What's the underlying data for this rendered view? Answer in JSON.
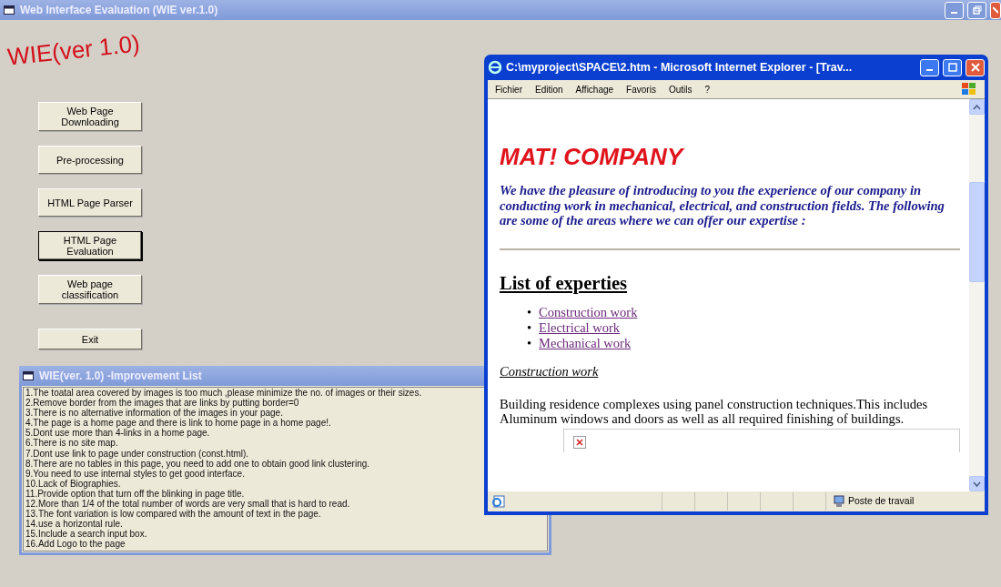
{
  "window": {
    "title": "Web Interface Evaluation (WIE ver.1.0)"
  },
  "logo": "WIE(ver 1.0)",
  "buttons": [
    {
      "label": "Web Page Downloading",
      "focused": false
    },
    {
      "label": "Pre-processing",
      "focused": false
    },
    {
      "label": "HTML Page Parser",
      "focused": false
    },
    {
      "label": "HTML Page Evaluation",
      "focused": true
    },
    {
      "label": "Web page classification",
      "focused": false
    },
    {
      "label": "Exit",
      "focused": false
    }
  ],
  "improvement_window": {
    "title": "WIE(ver. 1.0) -Improvement List",
    "items": [
      "1.The toatal area covered by images is too much ,please minimize the no. of images or their sizes.",
      "2.Remove border from the images that are links by putting border=0",
      "3.There is no alternative information of the images in your page.",
      "4.The page is a home page and there is link to home page in a home page!.",
      "5.Dont use more than 4-links in a home page.",
      "6.There is no site map.",
      "7.Dont use link to  page under construction (const.html).",
      "8.There are no tables in this page, you need to add one to obtain good link clustering.",
      "9.You need to use internal styles to get good interface.",
      "10.Lack of Biographies.",
      "11.Provide option that turn off the blinking in page title.",
      "12.More than 1/4 of the total number of words are very small that is hard to read.",
      "13.The font variation is low compared with the amount of text in the page.",
      "14.use a horizontal rule.",
      "15.Include a search input box.",
      "16.Add Logo to the page"
    ]
  },
  "browser": {
    "title": "C:\\myproject\\SPACE\\2.htm - Microsoft Internet Explorer - [Trav...",
    "menu": [
      "Fichier",
      "Edition",
      "Affichage",
      "Favoris",
      "Outils",
      "?"
    ],
    "page": {
      "heading": "MAT! COMPANY",
      "intro": "We have the pleasure of introducing to you the experience of our company in conducting work in mechanical, electrical, and construction fields. The following are some of the areas where we can offer our expertise :",
      "section_title": "List of experties",
      "links": [
        {
          "bullet": "•",
          "label": "Construction work"
        },
        {
          "bullet": "•",
          "label": "Electrical work"
        },
        {
          "bullet": "•",
          "label": "Mechanical work"
        }
      ],
      "subheading": "Construction work",
      "paragraph": "Building residence complexes using panel construction techniques.This includes Aluminum windows and doors as well as all required finishing of buildings."
    },
    "status_zone": "Poste de travail"
  }
}
